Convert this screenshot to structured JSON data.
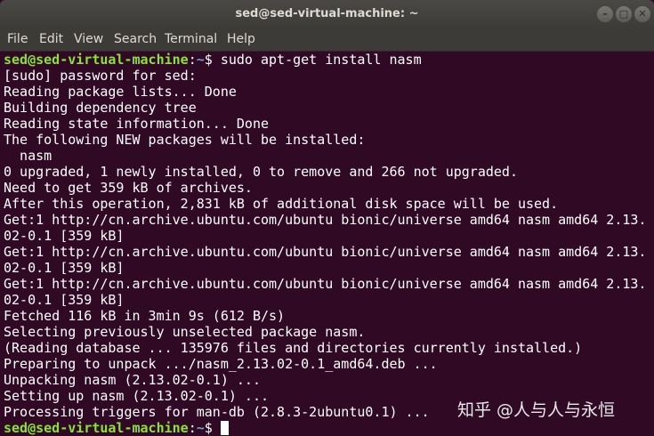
{
  "window": {
    "title": "sed@sed-virtual-machine: ~",
    "controls": {
      "minimize_icon": "–",
      "maximize_icon": "□",
      "close_icon": "✕"
    }
  },
  "menu": [
    "File",
    "Edit",
    "View",
    "Search",
    "Terminal",
    "Help"
  ],
  "prompt": {
    "user_host": "sed@sed-virtual-machine",
    "separator": ":",
    "path": "~",
    "symbol": "$ "
  },
  "command": "sudo apt-get install nasm",
  "output": [
    "[sudo] password for sed:",
    "Reading package lists... Done",
    "Building dependency tree",
    "Reading state information... Done",
    "The following NEW packages will be installed:",
    "  nasm",
    "0 upgraded, 1 newly installed, 0 to remove and 266 not upgraded.",
    "Need to get 359 kB of archives.",
    "After this operation, 2,831 kB of additional disk space will be used.",
    "Get:1 http://cn.archive.ubuntu.com/ubuntu bionic/universe amd64 nasm amd64 2.13.",
    "02-0.1 [359 kB]",
    "Get:1 http://cn.archive.ubuntu.com/ubuntu bionic/universe amd64 nasm amd64 2.13.",
    "02-0.1 [359 kB]",
    "Get:1 http://cn.archive.ubuntu.com/ubuntu bionic/universe amd64 nasm amd64 2.13.",
    "02-0.1 [359 kB]",
    "Fetched 116 kB in 3min 9s (612 B/s)",
    "Selecting previously unselected package nasm.",
    "(Reading database ... 135976 files and directories currently installed.)",
    "Preparing to unpack .../nasm_2.13.02-0.1_amd64.deb ...",
    "Unpacking nasm (2.13.02-0.1) ...",
    "Setting up nasm (2.13.02-0.1) ...",
    "Processing triggers for man-db (2.8.3-2ubuntu0.1) ..."
  ],
  "watermark": "知乎 @人与人与永恒",
  "colors": {
    "background": "#300a24",
    "prompt_user": "#8ae234",
    "prompt_path": "#729fcf",
    "text": "#ffffff",
    "titlebar": "#3c3b37"
  }
}
